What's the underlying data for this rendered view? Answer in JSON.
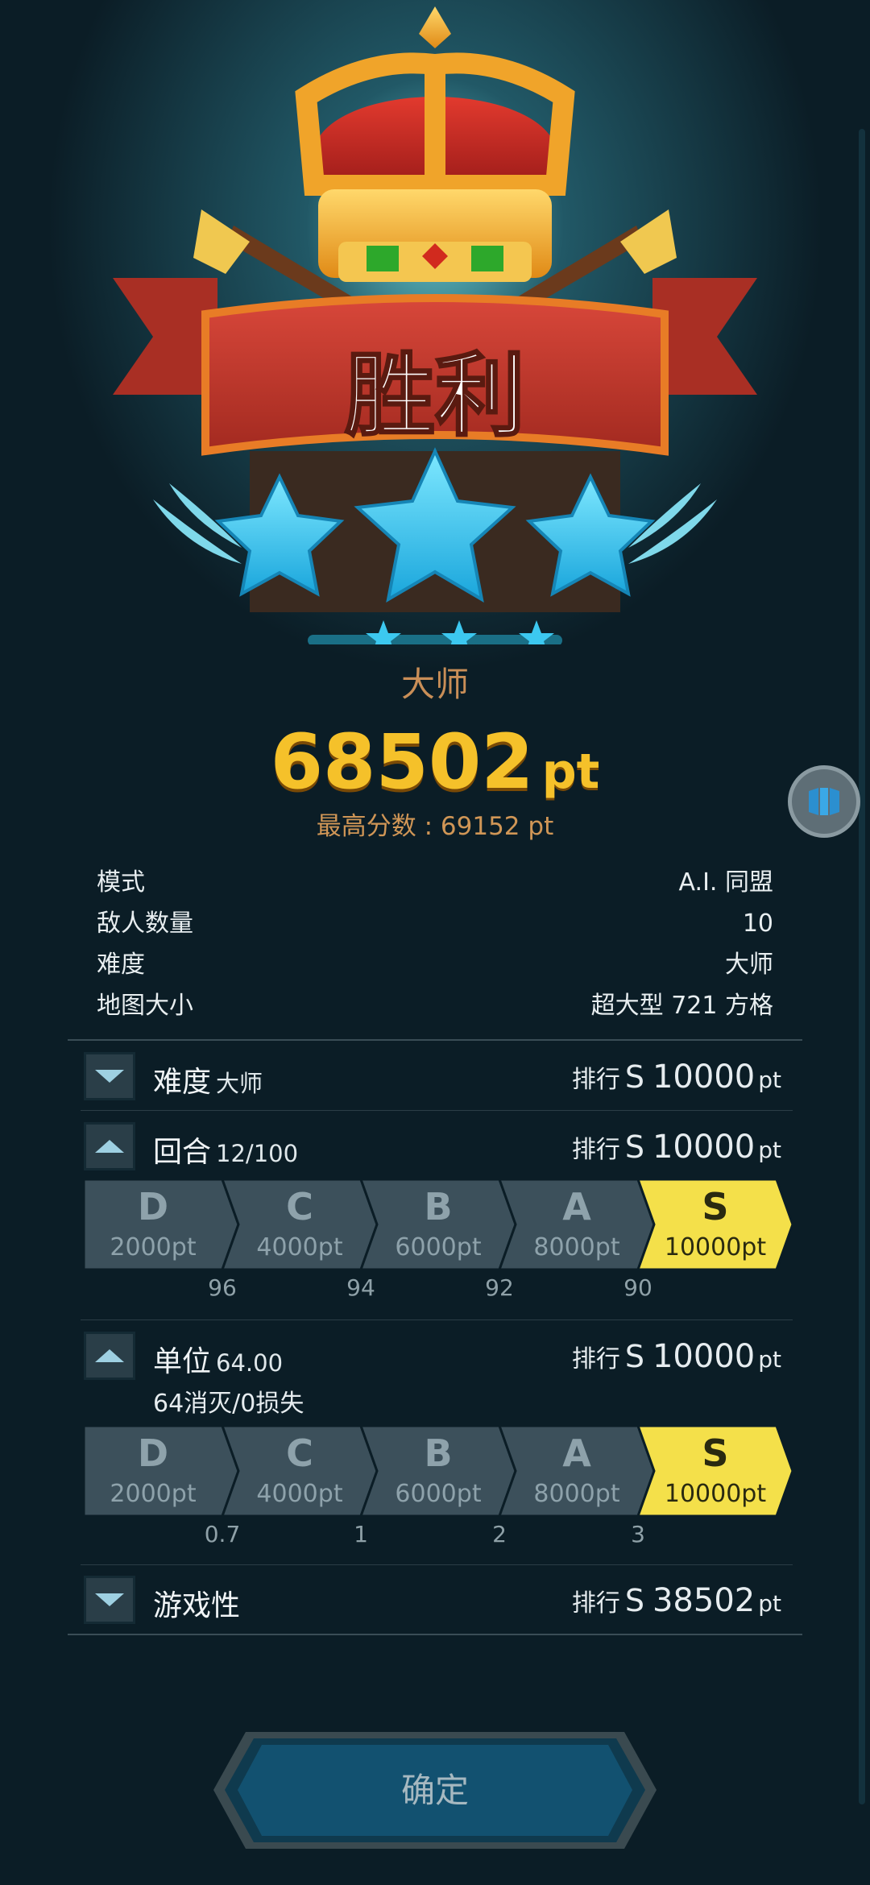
{
  "result": {
    "title": "胜利",
    "rank_label": "大师",
    "stars_earned": 3,
    "score_value": "68502",
    "score_unit": "pt",
    "best_score": "最高分数 : 69152 pt"
  },
  "info": [
    {
      "label": "模式",
      "value": "A.I. 同盟"
    },
    {
      "label": "敌人数量",
      "value": "10"
    },
    {
      "label": "难度",
      "value": "大师"
    },
    {
      "label": "地图大小",
      "value": "超大型 721 方格"
    }
  ],
  "sections": [
    {
      "title": "难度",
      "sub": "大师",
      "expanded": false,
      "rank_prefix": "排行",
      "grade": "S",
      "value": "10000",
      "unit": "pt"
    },
    {
      "title": "回合",
      "sub": "12/100",
      "expanded": true,
      "rank_prefix": "排行",
      "grade": "S",
      "value": "10000",
      "unit": "pt",
      "tiers": [
        {
          "letter": "D",
          "points": "2000",
          "unit": "pt"
        },
        {
          "letter": "C",
          "points": "4000",
          "unit": "pt"
        },
        {
          "letter": "B",
          "points": "6000",
          "unit": "pt"
        },
        {
          "letter": "A",
          "points": "8000",
          "unit": "pt"
        },
        {
          "letter": "S",
          "points": "10000",
          "unit": "pt"
        }
      ],
      "thresholds": [
        "96",
        "94",
        "92",
        "90"
      ]
    },
    {
      "title": "单位",
      "sub": "64.00",
      "detail": "64消灭/0损失",
      "expanded": true,
      "rank_prefix": "排行",
      "grade": "S",
      "value": "10000",
      "unit": "pt",
      "tiers": [
        {
          "letter": "D",
          "points": "2000",
          "unit": "pt"
        },
        {
          "letter": "C",
          "points": "4000",
          "unit": "pt"
        },
        {
          "letter": "B",
          "points": "6000",
          "unit": "pt"
        },
        {
          "letter": "A",
          "points": "8000",
          "unit": "pt"
        },
        {
          "letter": "S",
          "points": "10000",
          "unit": "pt"
        }
      ],
      "thresholds": [
        "0.7",
        "1",
        "2",
        "3"
      ]
    },
    {
      "title": "游戏性",
      "expanded": false,
      "rank_prefix": "排行",
      "grade": "S",
      "value": "38502",
      "unit": "pt"
    }
  ],
  "confirm_label": "确定",
  "colors": {
    "background": "#0b1d26",
    "score_gold": "#f5c12a",
    "rank_brown": "#c98e57",
    "active_tier": "#f4e04a",
    "inactive_tier": "#3c505b",
    "star_cyan": "#2cc6f0",
    "banner_red": "#c23a2a"
  },
  "icons": [
    "crown-icon",
    "trumpet-icon",
    "laurel-icon",
    "star-icon",
    "view-toggle-icon",
    "chevron-down-icon",
    "chevron-up-icon"
  ]
}
